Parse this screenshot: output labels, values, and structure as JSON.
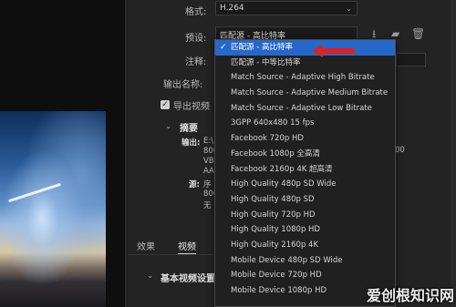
{
  "format": {
    "label": "格式:",
    "value": "H.264"
  },
  "preset": {
    "label": "预设:",
    "value": "匹配源 - 高比特率"
  },
  "comment": {
    "label": "注释:"
  },
  "output_name": {
    "label": "输出名称:"
  },
  "export_video": {
    "label": "导出视频",
    "checked": true
  },
  "summary": {
    "heading": "摘要",
    "output_label": "输出:",
    "output_lines": [
      "E:\\",
      "800",
      "VB",
      "AA"
    ],
    "source_label": "源:",
    "source_lines": [
      "序",
      "800",
      "无"
    ],
    "right_value": "00"
  },
  "tabs": {
    "effects": "效果",
    "video": "视频"
  },
  "basic_video_settings": "基本视频设置",
  "preset_options": [
    "匹配源 - 高比特率",
    "匹配源 - 中等比特率",
    "Match Source - Adaptive High Bitrate",
    "Match Source - Adaptive Medium Bitrate",
    "Match Source - Adaptive Low Bitrate",
    "3GPP 640x480 15 fps",
    "Facebook 720p HD",
    "Facebook 1080p 全高清",
    "Facebook 2160p 4K 超高清",
    "High Quality 480p SD Wide",
    "High Quality 480p SD",
    "High Quality 720p HD",
    "High Quality 1080p HD",
    "High Quality 2160p 4K",
    "Mobile Device 480p SD Wide",
    "Mobile Device 720p HD",
    "Mobile Device 1080p HD"
  ],
  "selected_index": 0,
  "icons": [
    "download-preset-icon",
    "import-preset-icon",
    "delete-preset-icon",
    "chevron-down-icon",
    "checkmark-icon",
    "collapse-triangle-icon"
  ],
  "accent_color": "#2668c9",
  "arrow_color": "#e02020",
  "watermark": "爱创根知识网"
}
